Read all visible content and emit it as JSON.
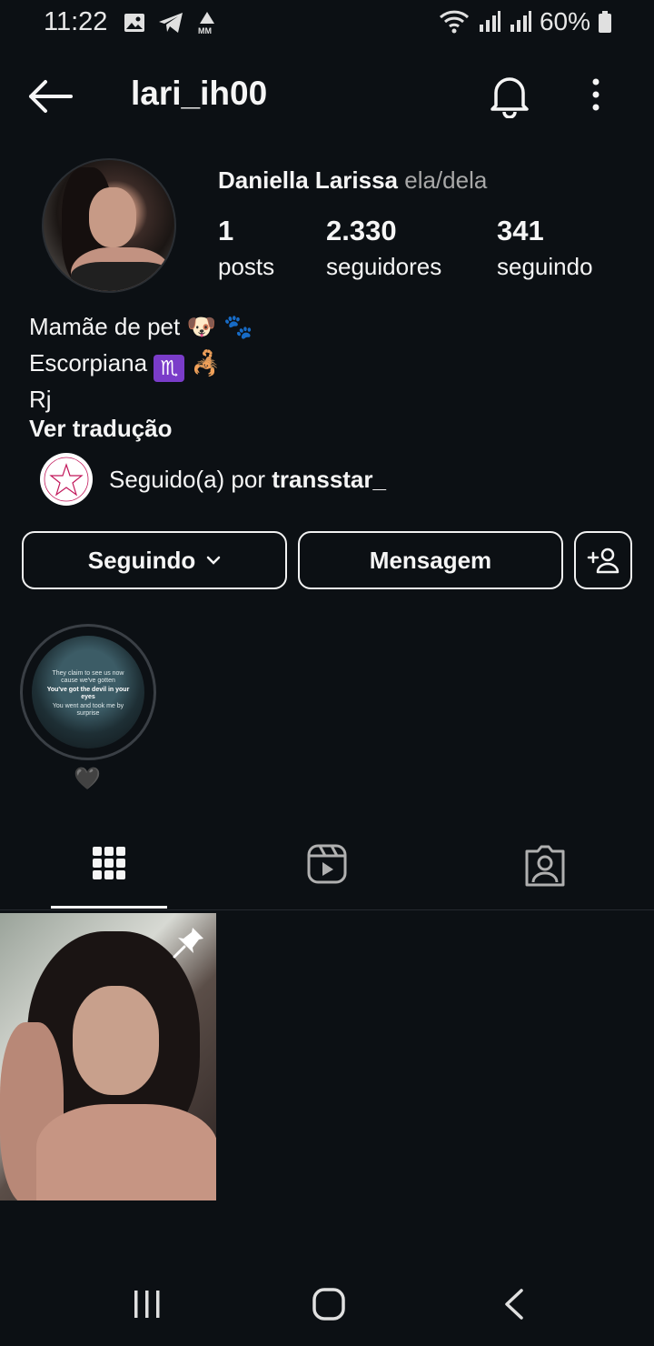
{
  "status_bar": {
    "time": "11:22",
    "battery": "60%"
  },
  "header": {
    "username": "lari_ih00"
  },
  "profile": {
    "display_name": "Daniella Larissa",
    "pronouns": "ela/dela",
    "stats": {
      "posts_count": "1",
      "posts_label": "posts",
      "followers_count": "2.330",
      "followers_label": "seguidores",
      "following_count": "341",
      "following_label": "seguindo"
    },
    "bio": {
      "line1": "Mamãe de pet",
      "line1_emoji": "🐶 🐾",
      "line2": "Escorpiana",
      "line2_zodiac": "♏",
      "line2_emoji": "🦂",
      "line3": "Rj"
    },
    "see_translation": "Ver tradução",
    "followed_by_prefix": "Seguido(a) por",
    "followed_by_user": "transstar_"
  },
  "actions": {
    "following_label": "Seguindo",
    "message_label": "Mensagem"
  },
  "highlight": {
    "label": "🖤",
    "text_lines": [
      "They claim to see us now",
      "cause we've gotten",
      "You've got the devil in your",
      "eyes",
      "You went and took me by",
      "surprise"
    ]
  },
  "tabs": [
    "grid",
    "reels",
    "tagged"
  ],
  "colors": {
    "background": "#0c1014",
    "text": "#f5f5f5",
    "muted": "#a8a8a8",
    "zodiac": "#7a3cc9"
  }
}
